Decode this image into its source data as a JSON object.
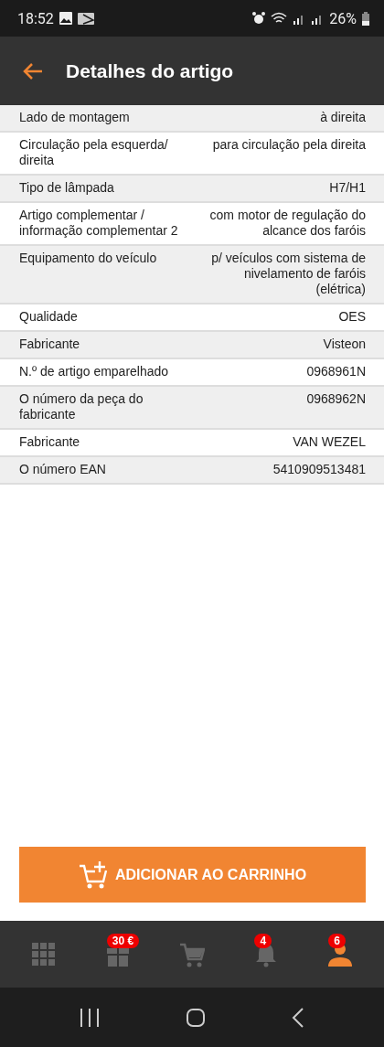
{
  "status_bar": {
    "time": "18:52",
    "battery": "26%"
  },
  "app_bar": {
    "title": "Detalhes do artigo"
  },
  "details": [
    {
      "label": "Lado de montagem",
      "value": "à direita"
    },
    {
      "label": "Circulação pela esquerda/ direita",
      "value": "para circulação pela direita"
    },
    {
      "label": "Tipo de lâmpada",
      "value": "H7/H1"
    },
    {
      "label": "Artigo complementar / informação complementar 2",
      "value": "com motor de regulação do alcance dos faróis"
    },
    {
      "label": "Equipamento do veículo",
      "value": "p/ veículos com sistema de nivelamento de faróis (elétrica)"
    },
    {
      "label": "Qualidade",
      "value": "OES"
    },
    {
      "label": "Fabricante",
      "value": "Visteon"
    },
    {
      "label": "N.º de artigo emparelhado",
      "value": "0968961N"
    },
    {
      "label": "O número da peça do fabricante",
      "value": "0968962N"
    },
    {
      "label": "Fabricante",
      "value": "VAN WEZEL"
    },
    {
      "label": "O número EAN",
      "value": "5410909513481"
    }
  ],
  "add_to_cart_button": {
    "label": "ADICIONAR AO CARRINHO"
  },
  "bottom_nav": [
    {
      "kind": "grid",
      "selected": false
    },
    {
      "kind": "gift",
      "selected": false,
      "badge": "30 €"
    },
    {
      "kind": "cart",
      "selected": false
    },
    {
      "kind": "bell",
      "selected": false,
      "badge": "4"
    },
    {
      "kind": "person",
      "selected": true,
      "badge": "6"
    }
  ]
}
